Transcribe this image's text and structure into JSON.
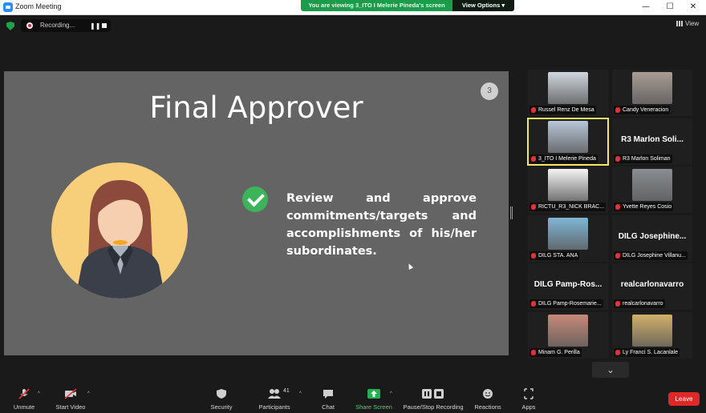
{
  "window": {
    "title": "Zoom Meeting",
    "minimize": "—",
    "maximize": "☐",
    "close": "✕"
  },
  "share_banner": {
    "text": "You are viewing 3_ITO I Melerie Pineda's screen",
    "view_options": "View Options ▾"
  },
  "recording": {
    "label": "Recording...",
    "pause": "❚❚"
  },
  "view_button": "View",
  "slide": {
    "number": "3",
    "title": "Final Approver",
    "body": "Review and approve commitments/targets and accomplishments of his/her subordinates."
  },
  "gallery": {
    "participants": [
      {
        "name": "Russel Renz De Mesa",
        "type": "video",
        "color": "#cfd6dd",
        "active": false
      },
      {
        "name": "Candy Veneracion",
        "type": "video",
        "color": "#a99c94",
        "active": false
      },
      {
        "name": "3_ITO I Melerie Pineda",
        "type": "video",
        "color": "#b8c6d8",
        "active": true
      },
      {
        "name": "R3 Marlon Soliman",
        "display": "R3  Marlon Soli...",
        "type": "name",
        "active": false
      },
      {
        "name": "RICTU_R3_NICK BRAC...",
        "type": "video",
        "color": "#f4f4f4",
        "active": false
      },
      {
        "name": "Yvette Reyes Cosio",
        "type": "video",
        "color": "#8a8e92",
        "active": false
      },
      {
        "name": "DILG STA. ANA",
        "type": "video",
        "color": "#7fb6d6",
        "active": false
      },
      {
        "name": "DILG Josephine Villanu...",
        "display": "DILG Josephine...",
        "type": "name",
        "active": false
      },
      {
        "name": "DILG Pamp-Rosemarie...",
        "display": "DILG Pamp-Ros...",
        "type": "name",
        "active": false
      },
      {
        "name": "realcarlonavarro",
        "display": "realcarlonavarro",
        "type": "name",
        "active": false
      },
      {
        "name": "Minam G. Perilla",
        "type": "video",
        "color": "#c78a78",
        "active": false
      },
      {
        "name": "Ly Franci S. Lacanlale",
        "type": "video",
        "color": "#d2b06a",
        "active": false
      }
    ],
    "scroll_down": "⌄"
  },
  "toolbar": {
    "unmute": "Unmute",
    "start_video": "Start Video",
    "security": "Security",
    "participants": "Participants",
    "participants_count": "41",
    "chat": "Chat",
    "share_screen": "Share Screen",
    "pause_stop_recording": "Pause/Stop Recording",
    "reactions": "Reactions",
    "apps": "Apps",
    "leave": "Leave",
    "caret": "^"
  },
  "colors": {
    "share_green": "#1a9c4a",
    "slide_bg": "#646464",
    "check_green": "#3cb45a",
    "leave_red": "#e02828",
    "active_speaker": "#f5e663",
    "avatar_yellow": "#f7cf7a"
  }
}
